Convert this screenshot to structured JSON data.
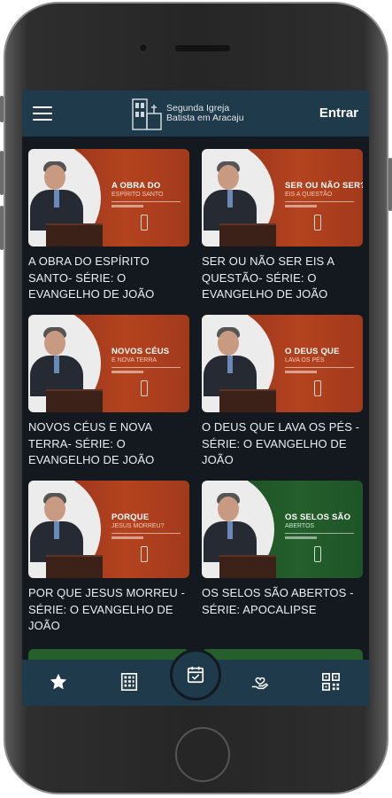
{
  "header": {
    "logo_line1": "Segunda Igreja",
    "logo_line2": "Batista em Aracaju",
    "login_label": "Entrar"
  },
  "cards": [
    {
      "title": "A OBRA DO ESPÍRITO SANTO- SÉRIE: O EVANGELHO DE JOÃO",
      "thumb_title": "A OBRA DO",
      "thumb_sub": "ESPÍRITO SANTO",
      "color": "red"
    },
    {
      "title": "SER OU NÃO SER EIS A QUESTÃO- SÉRIE: O EVANGELHO DE JOÃO",
      "thumb_title": "SER OU NÃO SER?",
      "thumb_sub": "EIS A QUESTÃO",
      "color": "red"
    },
    {
      "title": "NOVOS CÉUS E NOVA TERRA- SÉRIE: O EVANGELHO DE JOÃO",
      "thumb_title": "NOVOS CÉUS",
      "thumb_sub": "E NOVA TERRA",
      "color": "red"
    },
    {
      "title": "O DEUS QUE LAVA OS PÉS - SÉRIE: O EVANGELHO DE JOÃO",
      "thumb_title": "O DEUS QUE",
      "thumb_sub": "LAVA OS PÉS",
      "color": "red"
    },
    {
      "title": "POR QUE JESUS MORREU - SÉRIE: O EVANGELHO DE JOÃO",
      "thumb_title": "PORQUE",
      "thumb_sub": "JESUS MORREU?",
      "color": "red"
    },
    {
      "title": "OS SELOS SÃO ABERTOS - SÉRIE: APOCALIPSE",
      "thumb_title": "OS SELOS SÃO",
      "thumb_sub": "ABERTOS",
      "color": "green"
    }
  ],
  "nav": {
    "items": [
      "star-icon",
      "building-icon",
      "calendar-check-icon",
      "hand-heart-icon",
      "qr-code-icon"
    ]
  },
  "colors": {
    "appbar": "#1f3a4a",
    "background": "#13191e",
    "thumb_red": "#b4431f",
    "thumb_green": "#245f2c"
  }
}
